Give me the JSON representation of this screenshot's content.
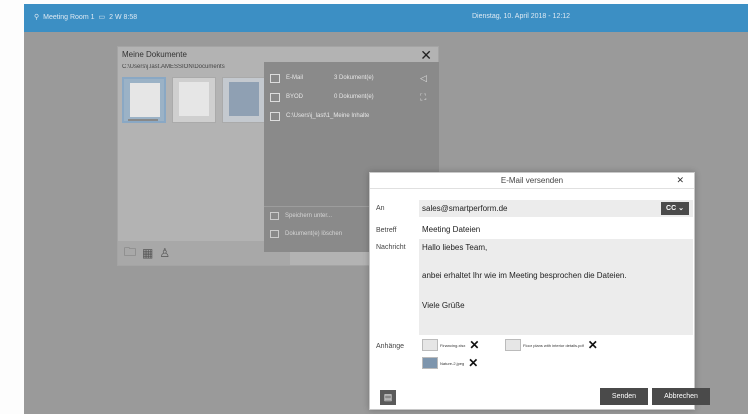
{
  "topbar": {
    "room": "Meeting Room 1",
    "session": "2 W 8:58",
    "datetime": "Dienstag, 10. April 2018 - 12:12"
  },
  "documents": {
    "title": "Meine Dokumente",
    "path": "C:\\Users\\j.last.AMESSION\\Documents",
    "close": "✕"
  },
  "share": {
    "email_label": "E-Mail",
    "email_count": "3 Dokument(e)",
    "byod_label": "BYOD",
    "byod_count": "0 Dokument(e)",
    "path_label": "C:\\Users\\j_last\\1_Meine Inhalte",
    "save_label": "Speichern unter...",
    "delete_label": "Dokument(e) löschen"
  },
  "mail": {
    "title": "E-Mail versenden",
    "close": "✕",
    "to_label": "An",
    "to_value": "sales@smartperform.de",
    "cc_label": "CC",
    "subject_label": "Betreff",
    "subject_value": "Meeting Dateien",
    "message_label": "Nachricht",
    "message_lines": [
      "Hallo liebes Team,",
      "anbei erhaltet Ihr wie im Meeting besprochen die Dateien.",
      "Viele Grüße"
    ],
    "attachments_label": "Anhänge",
    "attachments": [
      {
        "name": "Financing.xlsx"
      },
      {
        "name": "Floor plans with interior details.pdf"
      },
      {
        "name": "Nature-2.jpeg"
      }
    ],
    "send_label": "Senden",
    "cancel_label": "Abbrechen"
  }
}
